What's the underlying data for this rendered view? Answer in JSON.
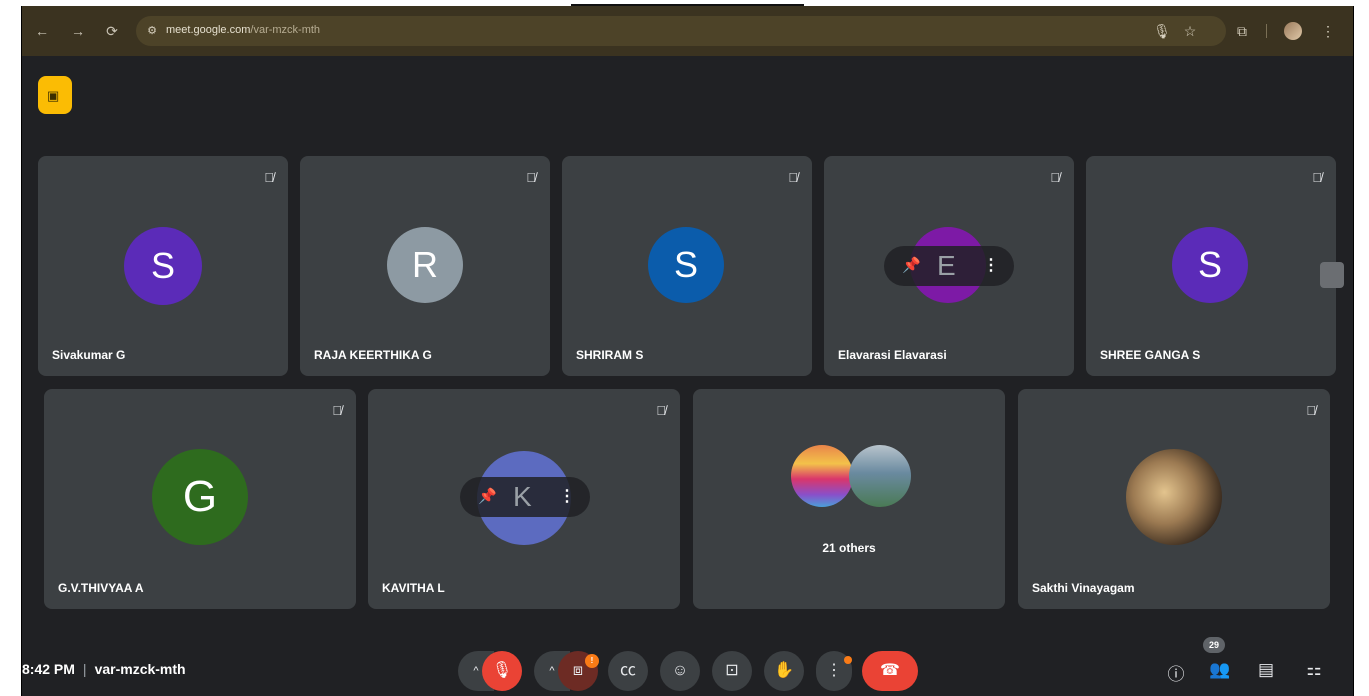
{
  "browser": {
    "url_host": "meet.google.com",
    "url_path": "/var-mzck-mth",
    "icons": [
      "back-icon",
      "forward-icon",
      "reload-icon",
      "site-info-icon",
      "mic-icon",
      "star-icon",
      "extensions-icon",
      "profile-avatar",
      "menu-dots-icon"
    ]
  },
  "participants_row1": [
    {
      "initial": "S",
      "name": "Sivakumar G",
      "color": "#5b2bb8"
    },
    {
      "initial": "R",
      "name": "RAJA KEERTHIKA G",
      "color": "#8d9aa3"
    },
    {
      "initial": "S",
      "name": "SHRIRAM S",
      "color": "#0b5cab"
    },
    {
      "initial": "E",
      "name": "Elavarasi Elavarasi",
      "color": "#7d1aa6"
    },
    {
      "initial": "S",
      "name": "SHREE GANGA S",
      "color": "#5b2bb8"
    }
  ],
  "participants_row2": [
    {
      "initial": "G",
      "name": "G.V.THIVYAA A",
      "color": "#2e6b1e"
    },
    {
      "initial": "K",
      "name": "KAVITHA L",
      "color": "#5c6bc0"
    },
    {
      "label": "21 others"
    },
    {
      "name": "Sakthi Vinayagam"
    }
  ],
  "meeting": {
    "time": "8:42 PM",
    "separator": "|",
    "code": "var-mzck-mth",
    "people_count": "29",
    "camera_badge": "!"
  },
  "colors": {
    "accent_red": "#ea4335",
    "tile_bg": "#3c4043",
    "bg": "#202124",
    "present_yellow": "#fbbc04"
  }
}
